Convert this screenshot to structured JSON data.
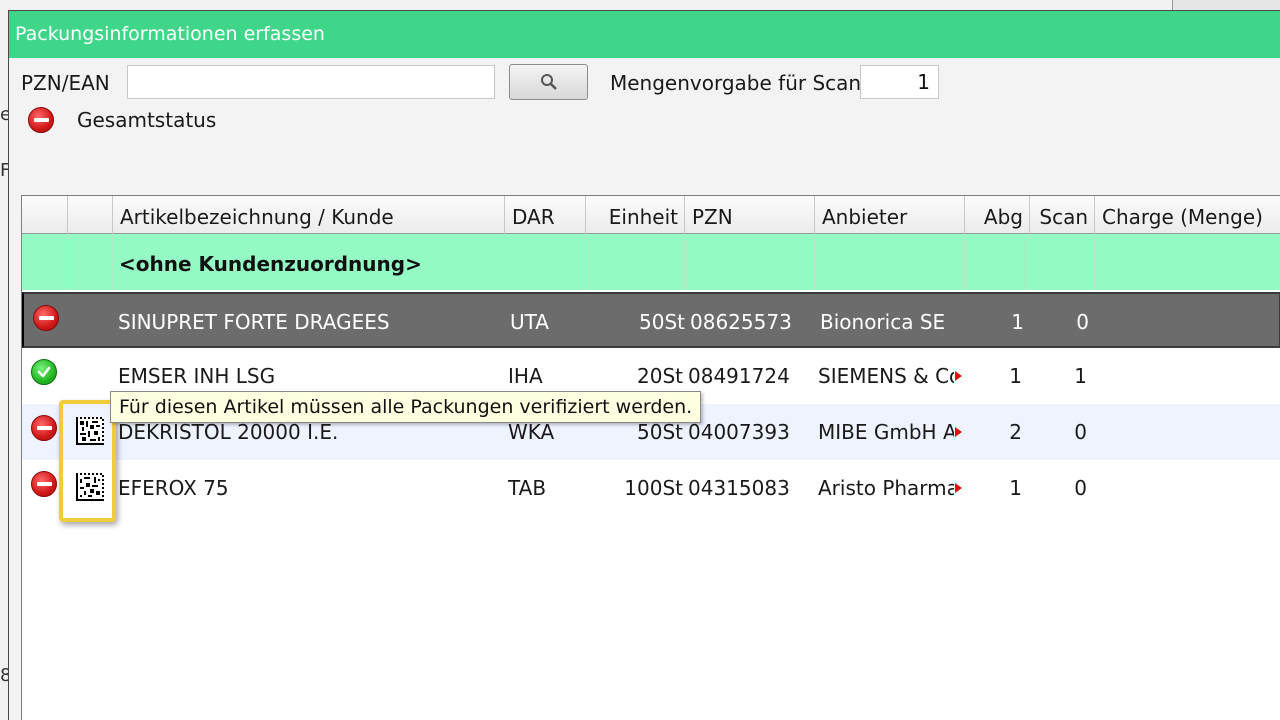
{
  "window": {
    "title": "Packungsinformationen erfassen"
  },
  "search": {
    "label": "PZN/EAN",
    "value": "",
    "button_icon": "magnifier-icon"
  },
  "scan_quantity": {
    "label": "Mengenvorgabe für Scan",
    "value": "1"
  },
  "overall_status": {
    "label": "Gesamtstatus",
    "status": "stop"
  },
  "table": {
    "columns": [
      "",
      "",
      "Artikelbezeichnung / Kunde",
      "DAR",
      "Einheit",
      "PZN",
      "Anbieter",
      "Abg",
      "Scan",
      "Charge (Menge)"
    ],
    "group_label": "<ohne Kundenzuordnung>",
    "rows": [
      {
        "status": "stop",
        "verify": false,
        "name": "SINUPRET FORTE DRAGEES",
        "dar": "UTA",
        "unit": "50St",
        "pzn": "08625573",
        "supplier": "Bionorica SE",
        "abg": "1",
        "scan": "0",
        "charge": ""
      },
      {
        "status": "ok",
        "verify": false,
        "name": "EMSER INH LSG",
        "dar": "IHA",
        "unit": "20St",
        "pzn": "08491724",
        "supplier": "SIEMENS & Co",
        "abg": "1",
        "scan": "1",
        "charge": ""
      },
      {
        "status": "stop",
        "verify": true,
        "name": "DEKRISTOL 20000 I.E.",
        "dar": "WKA",
        "unit": "50St",
        "pzn": "04007393",
        "supplier": "MIBE GmbH Ar",
        "abg": "2",
        "scan": "0",
        "charge": ""
      },
      {
        "status": "stop",
        "verify": true,
        "name": "EFEROX 75",
        "dar": "TAB",
        "unit": "100St",
        "pzn": "04315083",
        "supplier": "Aristo Pharma",
        "abg": "1",
        "scan": "0",
        "charge": ""
      }
    ]
  },
  "tooltip": {
    "text": "Für diesen Artikel müssen alle Packungen verifiziert werden."
  },
  "colors": {
    "titlebar": "#3fd68a",
    "group_row": "#94fbc4",
    "selected_row": "#6c6c6c",
    "highlight": "#f0cc3a"
  }
}
